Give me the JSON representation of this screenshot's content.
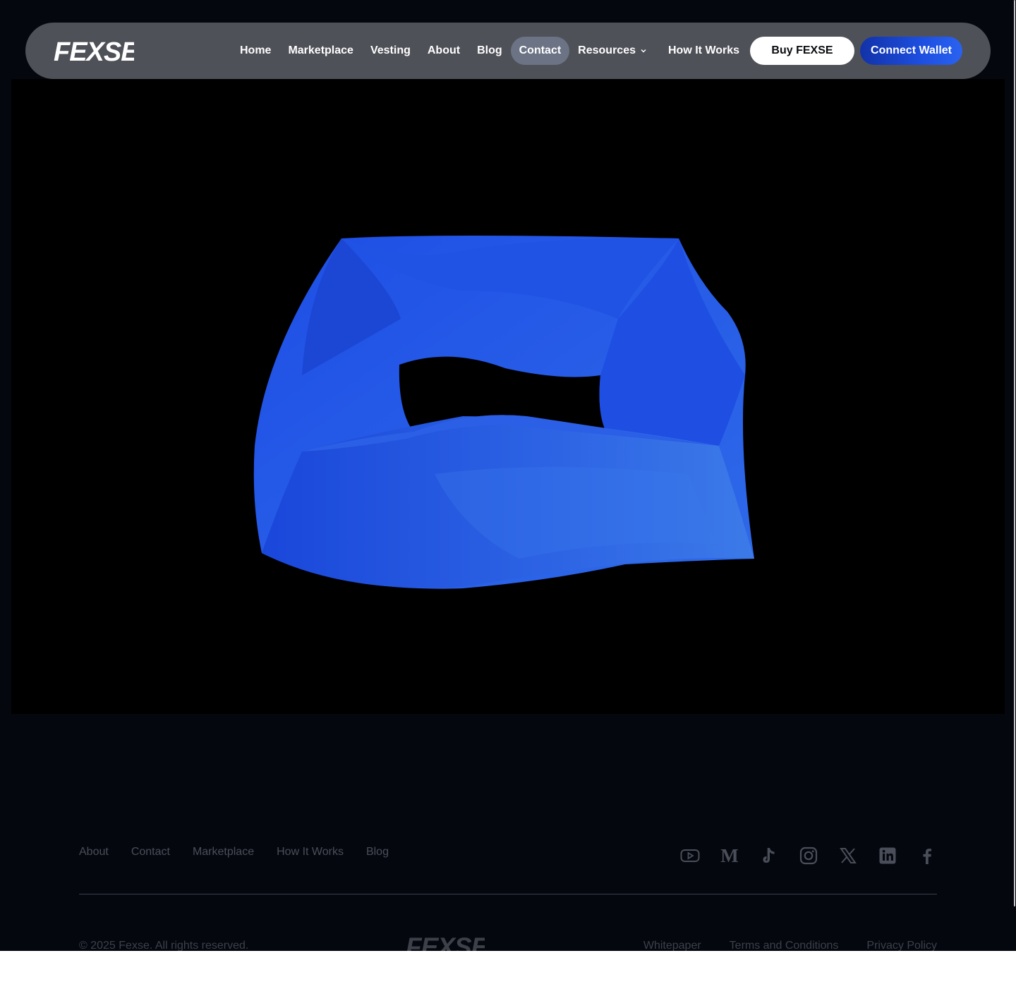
{
  "brand": {
    "name": "FEXSE"
  },
  "nav": {
    "links": [
      {
        "label": "Home"
      },
      {
        "label": "Marketplace"
      },
      {
        "label": "Vesting"
      },
      {
        "label": "About"
      },
      {
        "label": "Blog"
      },
      {
        "label": "Contact",
        "active": true
      },
      {
        "label": "Resources",
        "dropdown": true
      },
      {
        "label": "How It Works"
      }
    ],
    "buy_label": "Buy FEXSE",
    "connect_label": "Connect Wallet"
  },
  "footer": {
    "links": [
      "About",
      "Contact",
      "Marketplace",
      "How It Works",
      "Blog"
    ],
    "socials": [
      "youtube-icon",
      "medium-icon",
      "tiktok-icon",
      "instagram-icon",
      "x-icon",
      "linkedin-icon",
      "facebook-icon"
    ],
    "copyright": "© 2025 Fexse. All rights reserved.",
    "legal": [
      "Whitepaper",
      "Terms and Conditions",
      "Privacy Policy"
    ]
  },
  "colors": {
    "background": "#05070f",
    "nav_bg": "#4f5158",
    "active_pill": "#6b7384",
    "accent": "#1d4fe0",
    "muted_text": "#4a4e58"
  }
}
